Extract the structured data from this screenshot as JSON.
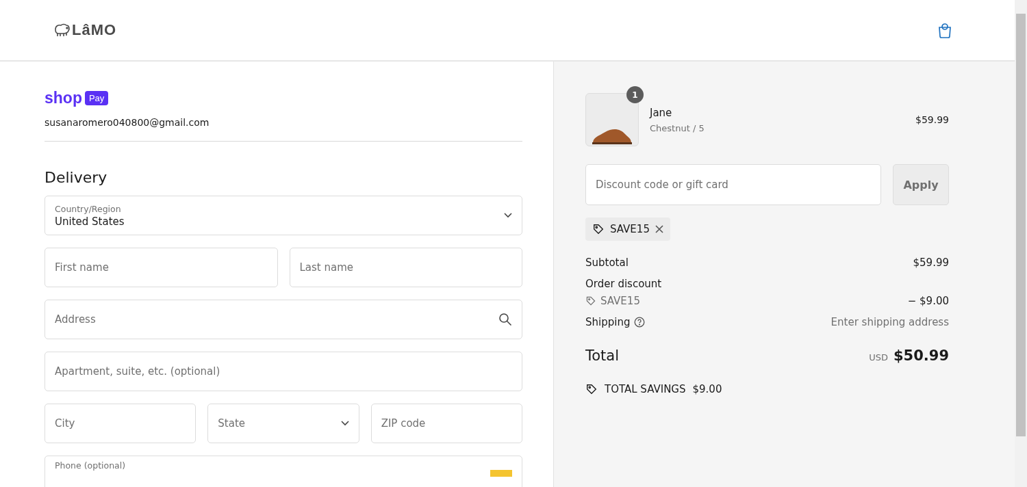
{
  "header": {
    "logo_text": "LâMO"
  },
  "shop_pay": {
    "wordmark": "shop",
    "badge": "Pay"
  },
  "account_email": "susanaromero040800@gmail.com",
  "delivery": {
    "title": "Delivery",
    "rows": [
      [
        {
          "kind": "select",
          "label": "Country/Region",
          "value": "United States"
        }
      ],
      [
        {
          "kind": "text",
          "placeholder": "First name"
        },
        {
          "kind": "text",
          "placeholder": "Last name"
        }
      ],
      [
        {
          "kind": "search",
          "placeholder": "Address"
        }
      ],
      [
        {
          "kind": "text",
          "placeholder": "Apartment, suite, etc. (optional)"
        }
      ],
      [
        {
          "kind": "text",
          "placeholder": "City"
        },
        {
          "kind": "select",
          "placeholder": "State"
        },
        {
          "kind": "text",
          "placeholder": "ZIP code"
        }
      ],
      [
        {
          "kind": "phone",
          "label": "Phone (optional)"
        }
      ]
    ]
  },
  "summary": {
    "item": {
      "quantity": "1",
      "name": "Jane",
      "variant": "Chestnut / 5",
      "price": "$59.99"
    },
    "discount_field": {
      "placeholder": "Discount code or gift card"
    },
    "apply_button": "Apply",
    "applied_code": "SAVE15",
    "lines": [
      {
        "kind": "plain",
        "label": "Subtotal",
        "value": "$59.99"
      },
      {
        "kind": "heading",
        "label": "Order discount"
      },
      {
        "kind": "code",
        "label": "SAVE15",
        "value": "− $9.00"
      },
      {
        "kind": "help",
        "label": "Shipping",
        "value": "Enter shipping address"
      }
    ],
    "total": {
      "label": "Total",
      "currency": "USD",
      "amount": "$50.99"
    },
    "savings": {
      "label": "TOTAL SAVINGS",
      "amount": "$9.00"
    }
  }
}
